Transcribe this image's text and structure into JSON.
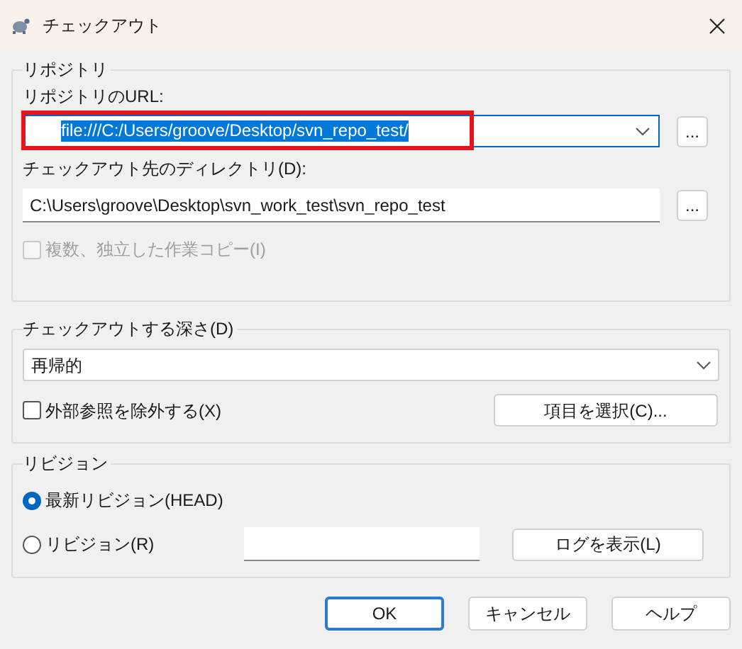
{
  "window": {
    "title": "チェックアウト"
  },
  "repository": {
    "legend": "リポジトリ",
    "url_label": "リポジトリのURL:",
    "url": {
      "value": "file:///C:/Users/groove/Desktop/svn_repo_test/",
      "text_selected": true,
      "highlighted": true
    },
    "url_browse": "...",
    "dir_label": "チェックアウト先のディレクトリ(D):",
    "dir": {
      "value": "C:\\Users\\groove\\Desktop\\svn_work_test\\svn_repo_test"
    },
    "dir_browse": "...",
    "multiple": {
      "label": "複数、独立した作業コピー(I)",
      "checked": false,
      "disabled": true
    }
  },
  "depth": {
    "legend": "チェックアウトする深さ(D)",
    "value": "再帰的",
    "omit_externals": {
      "label": "外部参照を除外する(X)",
      "checked": false,
      "disabled": false
    },
    "choose_items": "項目を選択(C)..."
  },
  "revision": {
    "legend": "リビジョン",
    "options": [
      {
        "label": "最新リビジョン(HEAD)",
        "selected": true
      },
      {
        "label": "リビジョン(R)",
        "selected": false
      }
    ],
    "show_log": "ログを表示(L)"
  },
  "buttons": [
    {
      "label": "OK",
      "default": true
    },
    {
      "label": "キャンセル",
      "default": false
    },
    {
      "label": "ヘルプ",
      "default": false
    }
  ]
}
